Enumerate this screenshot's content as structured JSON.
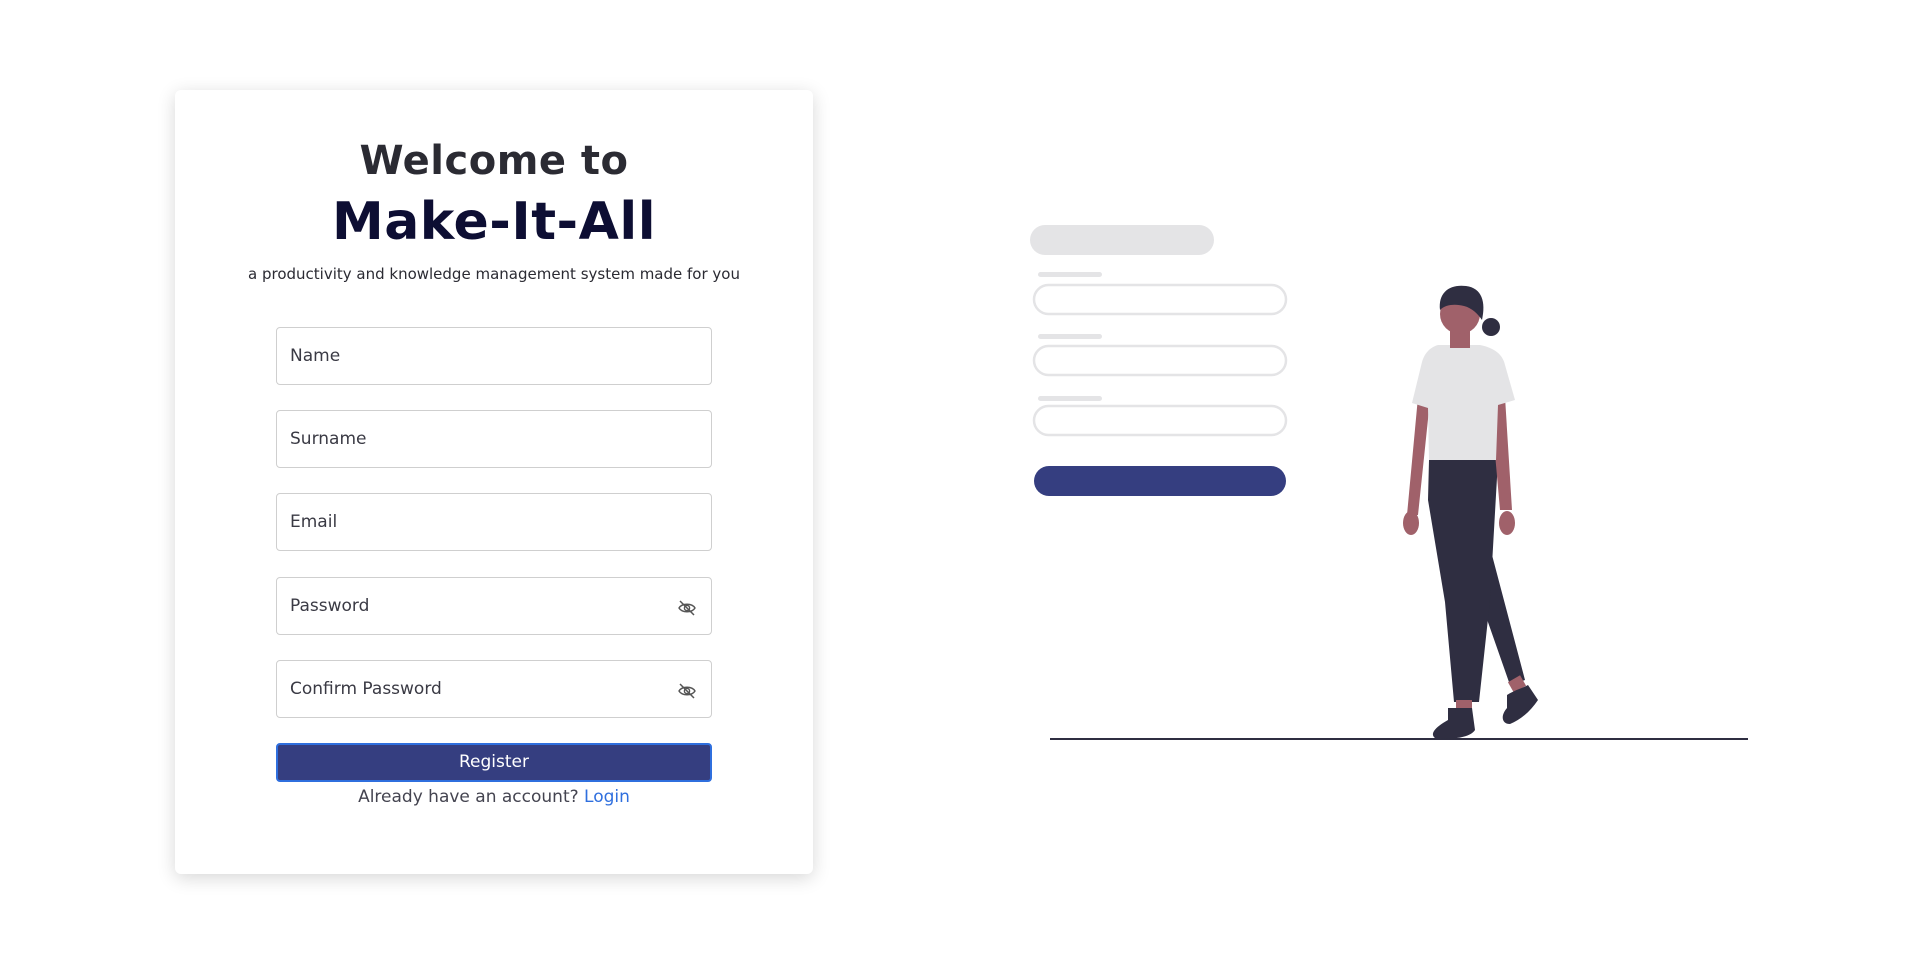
{
  "register_card": {
    "heading_line1": "Welcome to",
    "heading_line2": "Make-It-All",
    "tagline": "a productivity and knowledge management system made for you",
    "fields": [
      {
        "placeholder": "Name",
        "has_eye_icon": false
      },
      {
        "placeholder": "Surname",
        "has_eye_icon": false
      },
      {
        "placeholder": "Email",
        "has_eye_icon": false
      },
      {
        "placeholder": "Password",
        "has_eye_icon": true
      },
      {
        "placeholder": "Confirm Password",
        "has_eye_icon": true
      }
    ],
    "register_button_label": "Register",
    "login_prompt": "Already have an account?",
    "login_link_label": "Login"
  },
  "icons": {
    "password_toggle": "eye-slash-icon"
  },
  "colors": {
    "primary_button": "#353e80",
    "button_focus_border": "#2f6fde",
    "link": "#2f6fde",
    "brand_text": "#0d0e33"
  }
}
